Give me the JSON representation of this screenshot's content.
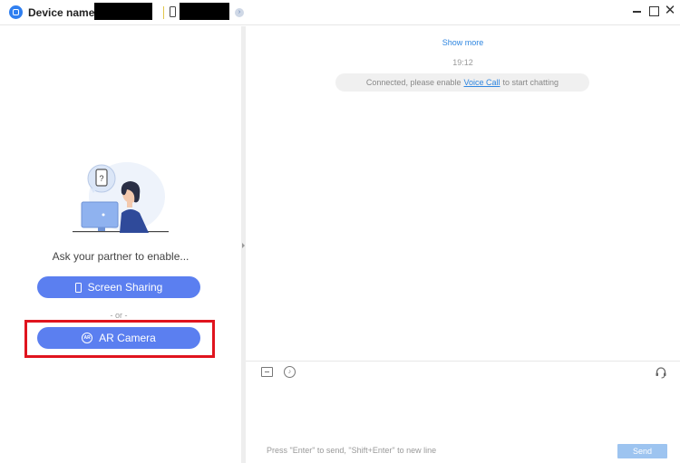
{
  "titlebar": {
    "device_label": "Device name:",
    "icons": [
      "app-logo-icon",
      "phone-icon",
      "info-icon",
      "minimize-icon",
      "maximize-icon",
      "close-icon"
    ],
    "close_glyph": "✕"
  },
  "left_pane": {
    "ask_text": "Ask your partner to enable...",
    "screen_sharing_label": "Screen Sharing",
    "or_text": "- or -",
    "ar_camera_label": "AR Camera",
    "ar_icon_text": "AR",
    "illustration_question": "?"
  },
  "chat": {
    "show_more": "Show more",
    "time": "19:12",
    "status_prefix": "Connected, please enable",
    "status_link": "Voice Call",
    "status_suffix": "to start chatting"
  },
  "input": {
    "hint": "Press \"Enter\" to send, \"Shift+Enter\" to new line",
    "send_label": "Send",
    "icons": [
      "folder-icon",
      "voice-icon",
      "headset-icon"
    ]
  },
  "colors": {
    "accent": "#5b7ff0",
    "link": "#2f86e0",
    "highlight": "#e0141e",
    "send_disabled": "#9dc4f0"
  }
}
